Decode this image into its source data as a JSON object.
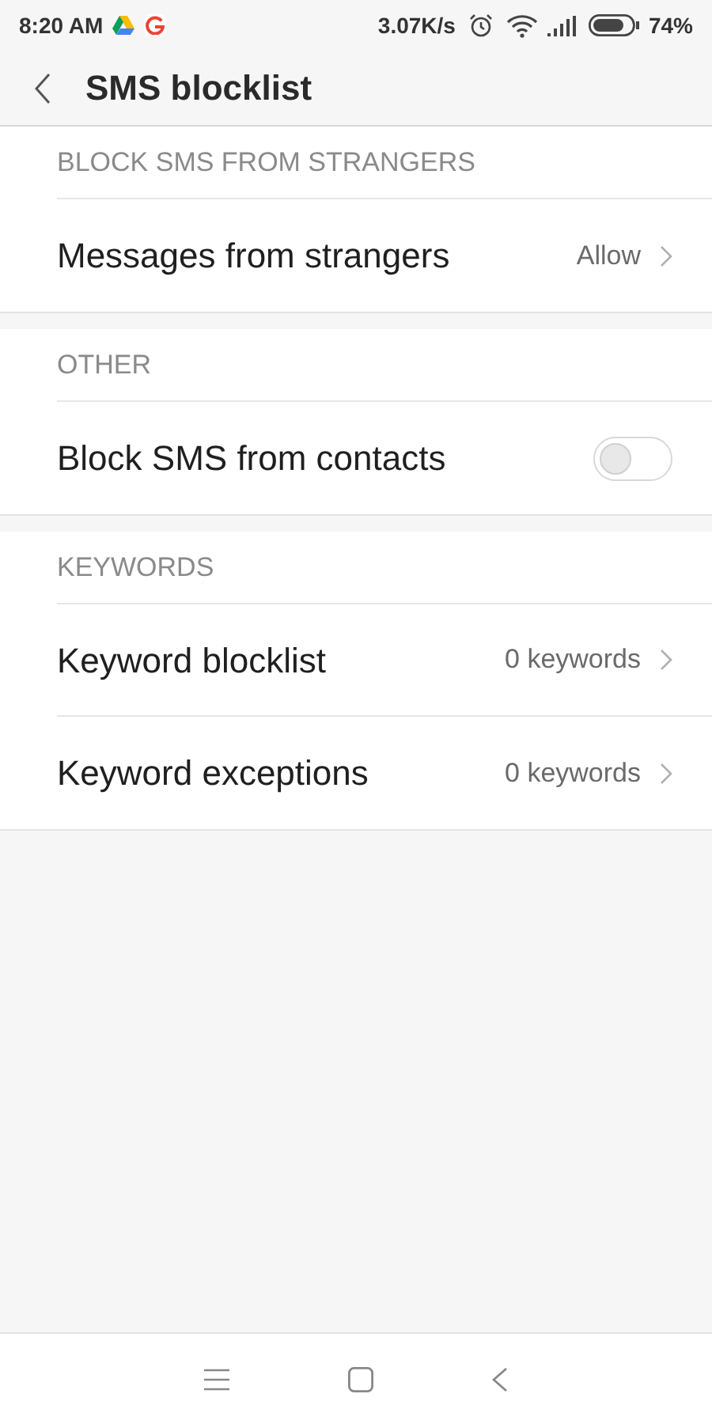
{
  "status_bar": {
    "time": "8:20 AM",
    "speed": "3.07K/s",
    "battery": "74%"
  },
  "header": {
    "title": "SMS blocklist"
  },
  "sections": [
    {
      "title": "BLOCK SMS FROM STRANGERS",
      "items": [
        {
          "kind": "link",
          "label": "Messages from strangers",
          "value": "Allow"
        }
      ]
    },
    {
      "title": "OTHER",
      "items": [
        {
          "kind": "toggle",
          "label": "Block SMS from contacts",
          "on": false
        }
      ]
    },
    {
      "title": "KEYWORDS",
      "items": [
        {
          "kind": "link",
          "label": "Keyword blocklist",
          "value": "0 keywords"
        },
        {
          "kind": "link",
          "label": "Keyword exceptions",
          "value": "0 keywords"
        }
      ]
    }
  ]
}
